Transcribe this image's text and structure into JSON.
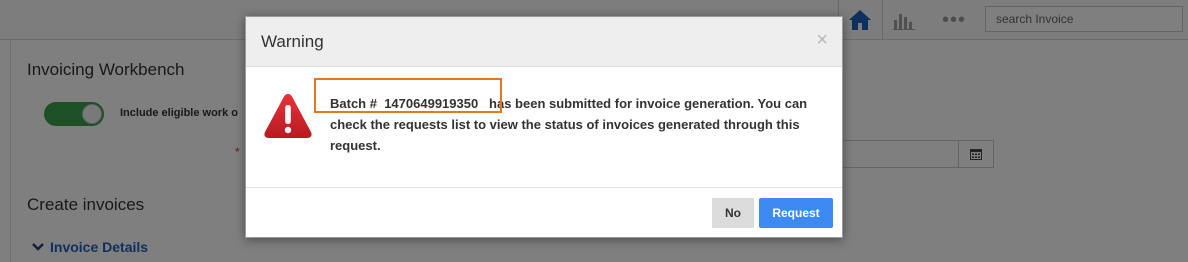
{
  "topbar": {
    "search_placeholder": "search Invoice",
    "icons": [
      "home-icon",
      "bar-chart-icon",
      "more-dots-icon"
    ],
    "accent_color": "#1f5fbf"
  },
  "page": {
    "heading": "Invoicing Workbench",
    "toggle_label": "Include eligible work o",
    "toggle_on": true,
    "required_marker": "*",
    "create_heading": "Create invoices",
    "details_link": "Invoice Details"
  },
  "modal": {
    "title": "Warning",
    "close_glyph": "×",
    "batch_label": "Batch #",
    "batch_number": "1470649919350",
    "message_rest": "has been submitted for invoice generation. You can check the requests list to view the status of invoices generated through this request.",
    "no_label": "No",
    "request_label": "Request",
    "request_color": "#3d8bf2",
    "highlight_color": "#e07a1e"
  }
}
